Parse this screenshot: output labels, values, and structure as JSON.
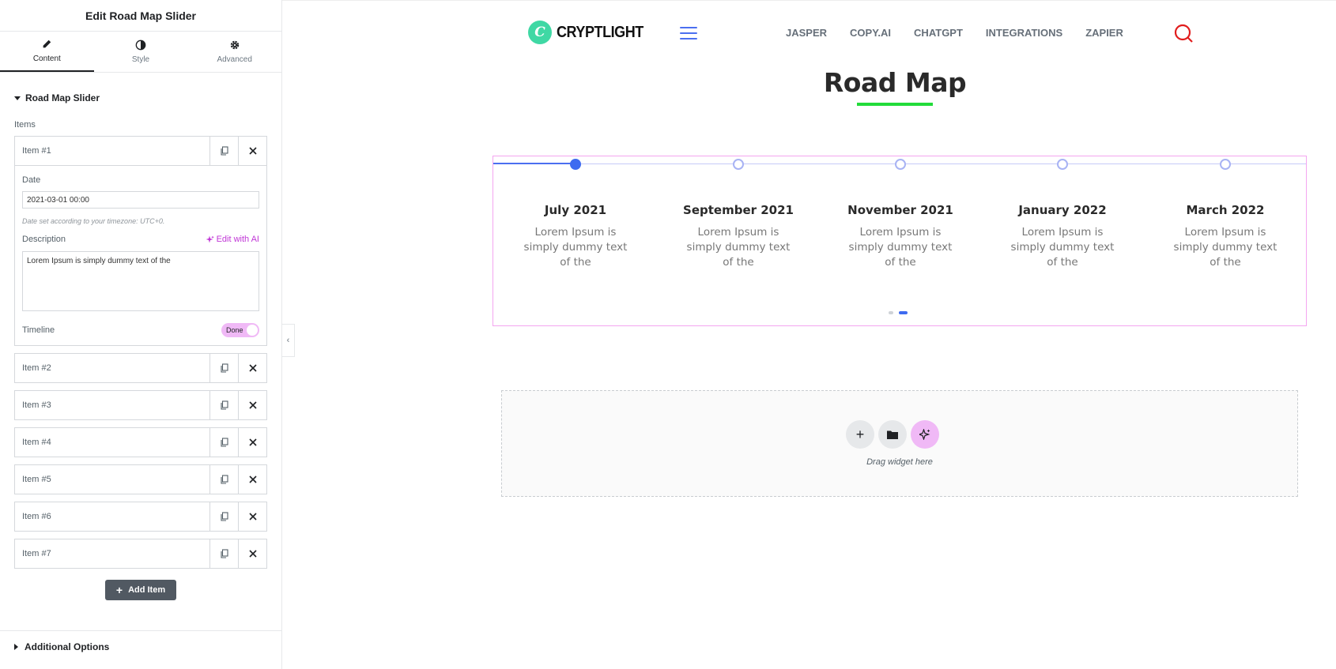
{
  "panel": {
    "title": "Edit Road Map Slider",
    "tabs": [
      {
        "label": "Content",
        "icon": "pencil-icon"
      },
      {
        "label": "Style",
        "icon": "half-circle-icon"
      },
      {
        "label": "Advanced",
        "icon": "gear-icon"
      }
    ],
    "section_title": "Road Map Slider",
    "items_label": "Items",
    "items": [
      {
        "title": "Item #1"
      },
      {
        "title": "Item #2"
      },
      {
        "title": "Item #3"
      },
      {
        "title": "Item #4"
      },
      {
        "title": "Item #5"
      },
      {
        "title": "Item #6"
      },
      {
        "title": "Item #7"
      }
    ],
    "open_item": {
      "date_label": "Date",
      "date_value": "2021-03-01 00:00",
      "timezone_hint": "Date set according to your timezone: UTC+0.",
      "description_label": "Description",
      "edit_ai_label": "Edit with AI",
      "description_value": "Lorem Ipsum is simply dummy text of the",
      "timeline_label": "Timeline",
      "timeline_toggle": "Done"
    },
    "add_item_label": "Add Item",
    "additional_options": "Additional Options"
  },
  "site": {
    "logo_text": "CRYPTLIGHT",
    "logo_mark": "C",
    "nav": [
      "JASPER",
      "COPY.AI",
      "CHATGPT",
      "INTEGRATIONS",
      "ZAPIER"
    ],
    "heading": "Road Map",
    "accent": "#22dc3a",
    "timeline_color": "#3e6bf0",
    "timeline": [
      {
        "date": "July 2021",
        "desc": "Lorem Ipsum is simply dummy text of the",
        "done": true
      },
      {
        "date": "September 2021",
        "desc": "Lorem Ipsum is simply dummy text of the",
        "done": false
      },
      {
        "date": "November 2021",
        "desc": "Lorem Ipsum is simply dummy text of the",
        "done": false
      },
      {
        "date": "January 2022",
        "desc": "Lorem Ipsum is simply dummy text of the",
        "done": false
      },
      {
        "date": "March 2022",
        "desc": "Lorem Ipsum is simply dummy text of the",
        "done": false
      }
    ],
    "pager": {
      "pages": 2,
      "active": 2
    }
  },
  "dropzone": {
    "text": "Drag widget here",
    "buttons": [
      "plus-icon",
      "folder-icon",
      "ai-sparkle-icon"
    ]
  }
}
